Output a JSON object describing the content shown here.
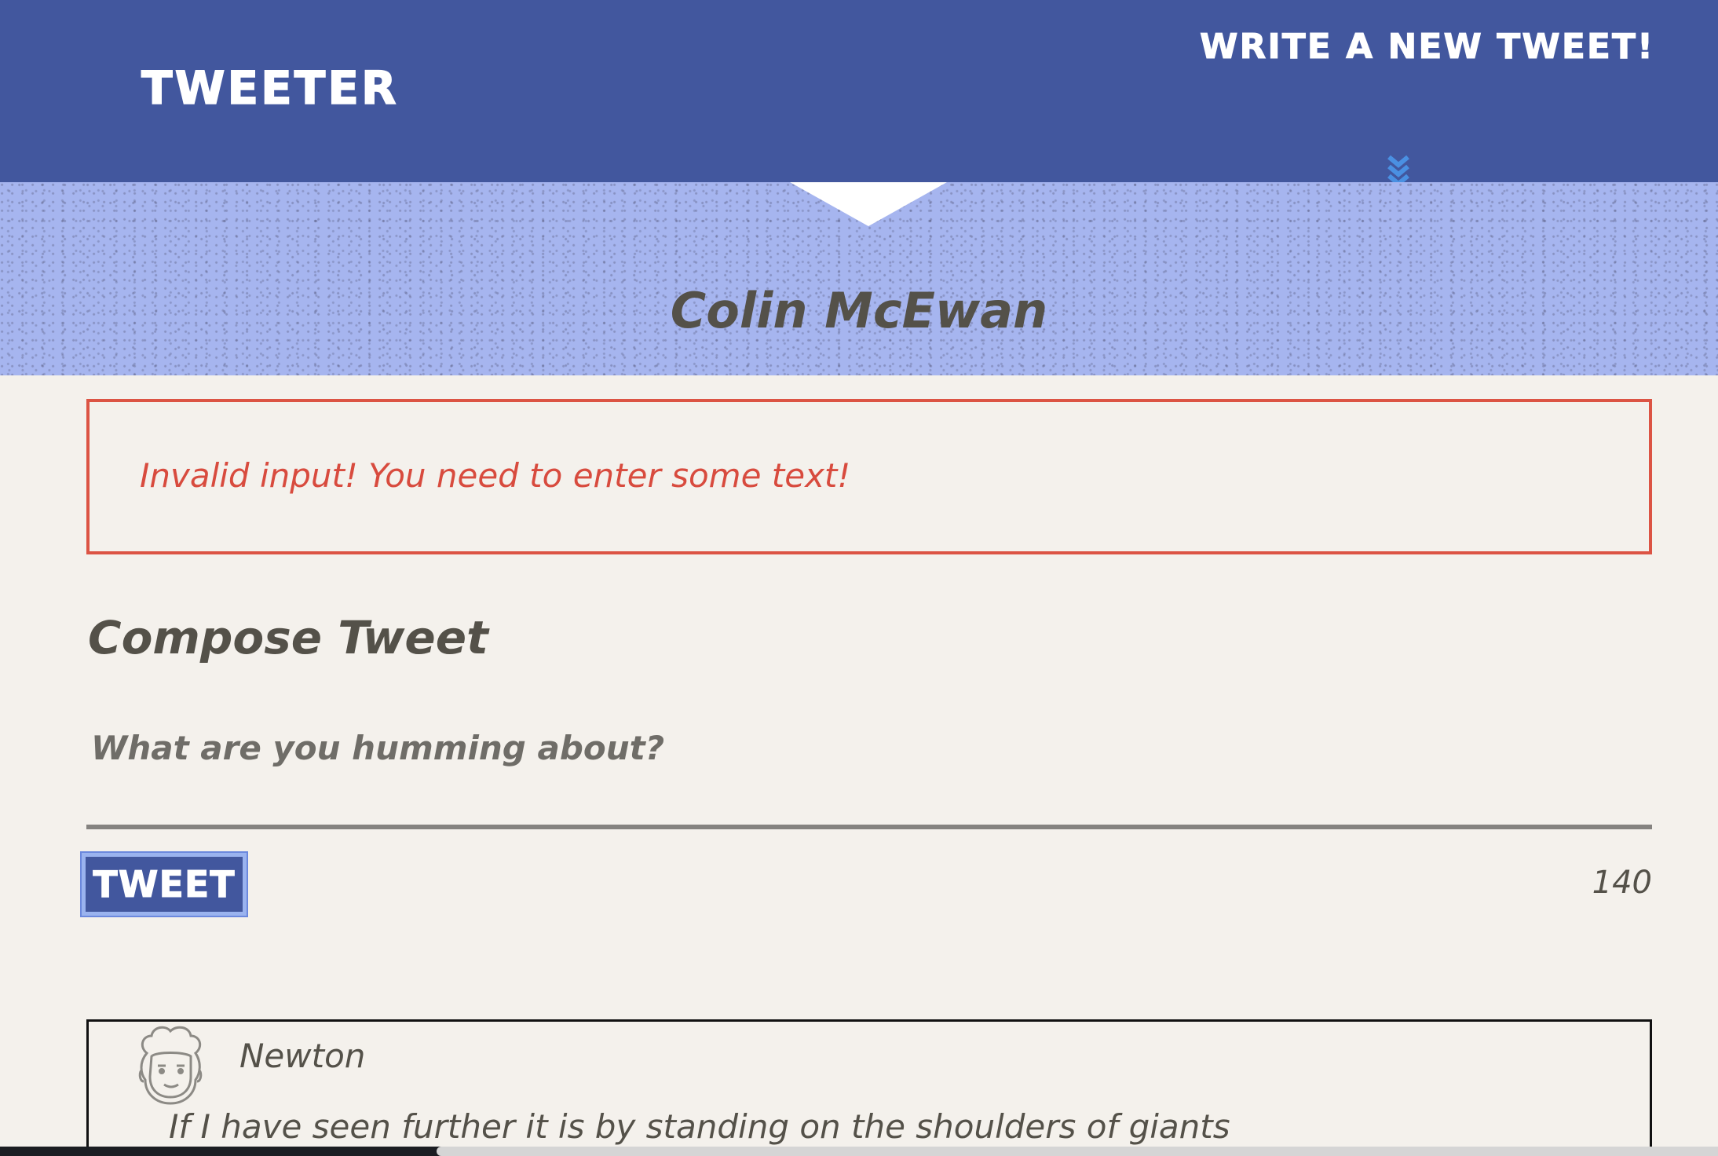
{
  "nav": {
    "brand": "TWEETER",
    "compose_link": "WRITE A NEW TWEET!",
    "toggle_icon": "double-chevron-down-icon"
  },
  "profile": {
    "name": "Colin McEwan"
  },
  "error": {
    "message": "Invalid input! You need to enter some text!"
  },
  "compose": {
    "title": "Compose Tweet",
    "placeholder": "What are you humming about?",
    "value": "",
    "button_label": "TWEET",
    "char_count": "140"
  },
  "tweets": [
    {
      "author": "Newton",
      "avatar_icon": "bearded-face-avatar-icon",
      "text": "If I have seen further it is by standing on the shoulders of giants"
    }
  ],
  "colors": {
    "nav_bg": "#42579e",
    "banner_bg": "#a6b5ef",
    "page_bg": "#f4f1ec",
    "error": "#dc5444",
    "text": "#545149",
    "chevron": "#4a90e2"
  }
}
